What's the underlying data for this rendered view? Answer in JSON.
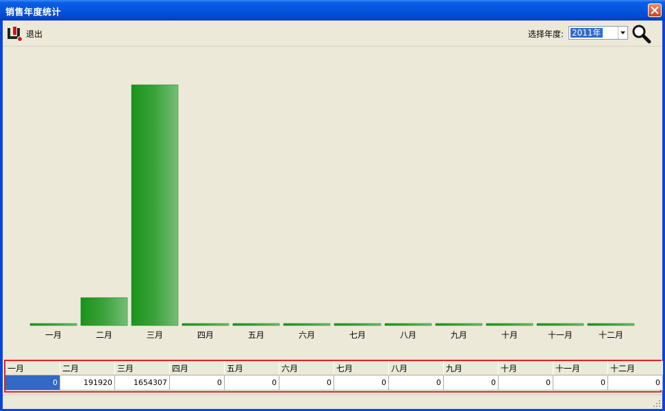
{
  "window": {
    "title": "销售年度统计",
    "close_icon": "close-icon"
  },
  "toolbar": {
    "exit_label": "退出",
    "exit_icon": "exit-icon",
    "year_label": "选择年度:",
    "year_value": "2011年",
    "search_icon": "search-icon"
  },
  "colors": {
    "bar": "#1e9a1e",
    "selection": "#316ac5",
    "border_highlight": "#e02020"
  },
  "chart_data": {
    "type": "bar",
    "categories": [
      "一月",
      "二月",
      "三月",
      "四月",
      "五月",
      "六月",
      "七月",
      "八月",
      "九月",
      "十月",
      "十一月",
      "十二月"
    ],
    "values": [
      0,
      191920,
      1654307,
      0,
      0,
      0,
      0,
      0,
      0,
      0,
      0,
      0
    ],
    "title": "",
    "xlabel": "",
    "ylabel": "",
    "ylim": [
      0,
      1654307
    ],
    "grid": false,
    "legend": "none"
  },
  "table": {
    "headers": [
      "一月",
      "二月",
      "三月",
      "四月",
      "五月",
      "六月",
      "七月",
      "八月",
      "九月",
      "十月",
      "十一月",
      "十二月"
    ],
    "values": [
      "0",
      "191920",
      "1654307",
      "0",
      "0",
      "0",
      "0",
      "0",
      "0",
      "0",
      "0",
      "0"
    ],
    "selected_col": 0
  }
}
